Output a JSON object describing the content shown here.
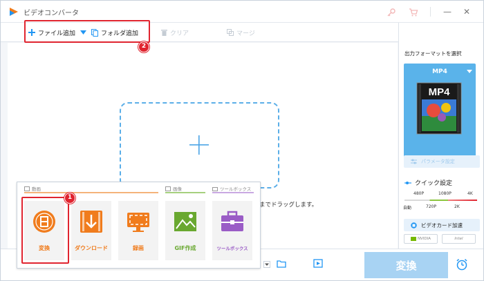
{
  "window": {
    "title": "ビデオコンバータ",
    "minimize_glyph": "—",
    "close_glyph": "✕"
  },
  "toolbar": {
    "add_file": "ファイル追加",
    "add_folder": "フォルダ追加",
    "clear": "クリア",
    "merge": "マージ"
  },
  "main": {
    "drop_hint": "までドラッグします。"
  },
  "right_panel": {
    "output_format_label": "出力フォーマットを選択",
    "selected_format": "MP4",
    "format_badge_text": "MP4",
    "params_button": "パラメータ設定",
    "quick_settings": {
      "label": "クイック設定",
      "top_ticks": [
        "480P",
        "1080P",
        "4K"
      ],
      "bottom_ticks": [
        "自動",
        "720P",
        "2K"
      ]
    },
    "gpu_button": "ビデオカード加速",
    "vendors": [
      "NVIDIA",
      "Intel"
    ]
  },
  "bottom": {
    "convert_button": "変換"
  },
  "popup": {
    "categories": [
      "動画",
      "画像",
      "ツールボックス"
    ],
    "tiles": [
      {
        "label": "変換",
        "color": "#f07c1d"
      },
      {
        "label": "ダウンロード",
        "color": "#f07c1d"
      },
      {
        "label": "録画",
        "color": "#f07c1d"
      },
      {
        "label": "GIF作成",
        "color": "#69a830"
      },
      {
        "label": "ツールボックス",
        "color": "#9a5cc6"
      }
    ]
  },
  "annotations": {
    "badge_1": "1",
    "badge_2": "2",
    "highlight_color": "#e0242f"
  },
  "colors": {
    "accent": "#2196f3",
    "format_box": "#5ab3ea",
    "convert_button": "#a8d3f3"
  }
}
